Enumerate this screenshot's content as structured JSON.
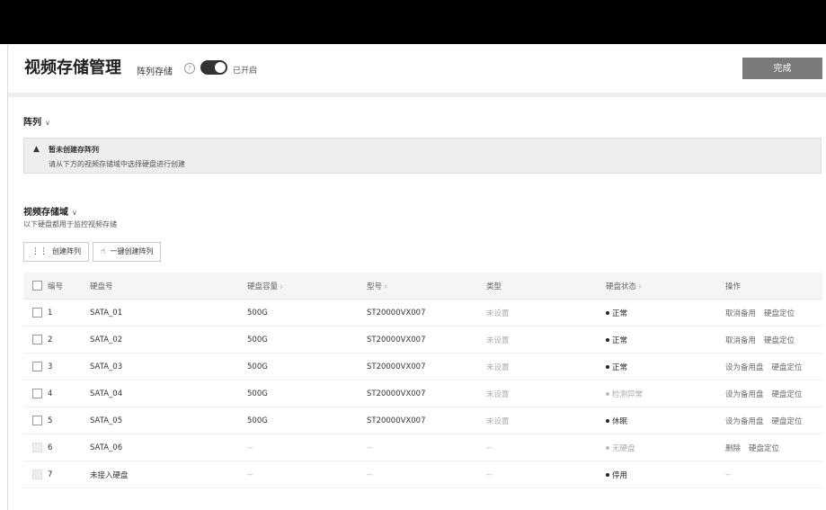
{
  "header": {
    "title": "视频存储管理",
    "array_storage_label": "阵列存储",
    "help_icon": "?",
    "toggle_text": "已开启",
    "done_label": "完成"
  },
  "array_section": {
    "title": "阵列",
    "alert_icon": "▲",
    "alert_title": "暂未创建存阵列",
    "alert_desc": "请从下方的视频存储域中选择硬盘进行创建"
  },
  "domain_section": {
    "title": "视频存储域",
    "desc": "以下硬盘都用于监控视频存储",
    "create_array_label": "创建阵列",
    "create_array_icon": "⋮⋮",
    "one_click_label": "一键创建阵列",
    "one_click_icon": "☝"
  },
  "table": {
    "headers": [
      "编号",
      "硬盘号",
      "硬盘容量",
      "型号",
      "类型",
      "硬盘状态",
      "操作"
    ],
    "sort_icon": "⊧",
    "rows": [
      {
        "no": "1",
        "disk": "SATA_01",
        "cap": "500G",
        "model": "ST20000VX007",
        "type": "未设置",
        "status": "正常",
        "a1": "取消备用",
        "a2": "硬盘定位"
      },
      {
        "no": "2",
        "disk": "SATA_02",
        "cap": "500G",
        "model": "ST20000VX007",
        "type": "未设置",
        "status": "正常",
        "a1": "取消备用",
        "a2": "硬盘定位"
      },
      {
        "no": "3",
        "disk": "SATA_03",
        "cap": "500G",
        "model": "ST20000VX007",
        "type": "未设置",
        "status": "正常",
        "a1": "设为备用盘",
        "a2": "硬盘定位"
      },
      {
        "no": "4",
        "disk": "SATA_04",
        "cap": "500G",
        "model": "ST20000VX007",
        "type": "未设置",
        "status": "检测异常",
        "a1": "设为备用盘",
        "a2": "硬盘定位"
      },
      {
        "no": "5",
        "disk": "SATA_05",
        "cap": "500G",
        "model": "ST20000VX007",
        "type": "未设置",
        "status": "休眠",
        "a1": "设为备用盘",
        "a2": "硬盘定位"
      },
      {
        "no": "6",
        "disk": "SATA_06",
        "cap": "--",
        "model": "--",
        "type": "--",
        "status": "无硬盘",
        "a1": "删除",
        "a2": "硬盘定位"
      },
      {
        "no": "7",
        "disk": "未接入硬盘",
        "cap": "--",
        "model": "--",
        "type": "--",
        "status": "停用",
        "a1": "--",
        "a2": ""
      }
    ]
  }
}
